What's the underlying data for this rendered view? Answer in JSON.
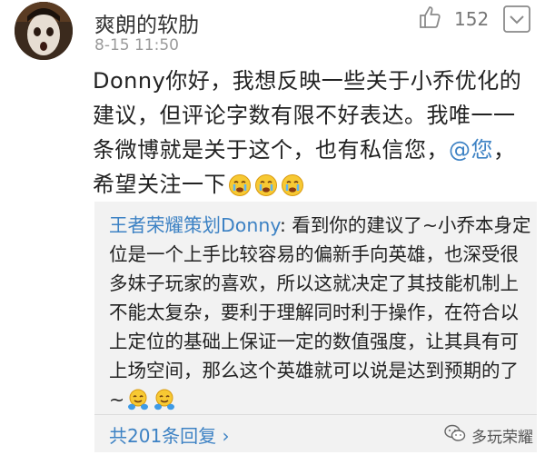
{
  "comment": {
    "username": "爽朗的软肋",
    "timestamp": "8-15 11:50",
    "like_count": "152",
    "text_before_mention": "Donny你好，我想反映一些关于小乔优化的建议，但评论字数有限不好表达。我唯一一条微博就是关于这个，也有私信您，",
    "mention": "@您",
    "text_after_mention": "，希望关注一下",
    "emoji_icons": [
      "crying-face-emoji",
      "crying-face-emoji",
      "crying-face-emoji"
    ]
  },
  "reply": {
    "author": "王者荣耀策划Donny",
    "text": ": 看到你的建议了~小乔本身定位是一个上手比较容易的偏新手向英雄，也深受很多妹子玩家的喜欢，所以这就决定了其技能机制上不能太复杂，要利于理解同时利于操作，在符合以上定位的基础上保证一定的数值强度，让其具有可上场空间，那么这个英雄就可以说是达到预期的了~",
    "emoji_icons": [
      "hugging-face-emoji",
      "hugging-face-emoji"
    ],
    "reply_count_label": "共201条回复 ›"
  },
  "watermark": {
    "text": "多玩荣耀"
  },
  "colors": {
    "link": "#3d82c4",
    "reply_background": "#f2f2f2",
    "meta": "#9a9a9a"
  }
}
